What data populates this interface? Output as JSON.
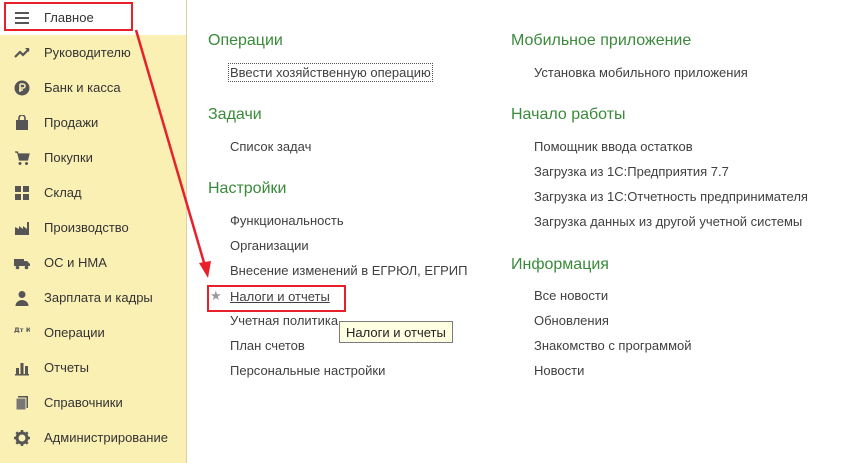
{
  "sidebar": {
    "items": [
      {
        "label": "Главное",
        "icon": "menu-lines-icon",
        "active": true
      },
      {
        "label": "Руководителю",
        "icon": "trend-up-icon"
      },
      {
        "label": "Банк и касса",
        "icon": "ruble-coin-icon"
      },
      {
        "label": "Продажи",
        "icon": "shopping-bag-icon"
      },
      {
        "label": "Покупки",
        "icon": "shopping-cart-icon"
      },
      {
        "label": "Склад",
        "icon": "warehouse-grid-icon"
      },
      {
        "label": "Производство",
        "icon": "factory-icon"
      },
      {
        "label": "ОС и НМА",
        "icon": "truck-icon"
      },
      {
        "label": "Зарплата и кадры",
        "icon": "person-icon"
      },
      {
        "label": "Операции",
        "icon": "debit-credit-icon"
      },
      {
        "label": "Отчеты",
        "icon": "bar-chart-icon"
      },
      {
        "label": "Справочники",
        "icon": "books-icon"
      },
      {
        "label": "Администрирование",
        "icon": "gear-icon"
      }
    ],
    "icon_glyph_dtkt": "Дт Кт"
  },
  "left_column": {
    "operations": {
      "title": "Операции",
      "links": [
        "Ввести хозяйственную операцию"
      ]
    },
    "tasks": {
      "title": "Задачи",
      "links": [
        "Список задач"
      ]
    },
    "settings": {
      "title": "Настройки",
      "links": [
        "Функциональность",
        "Организации",
        "Внесение изменений в ЕГРЮЛ, ЕГРИП",
        "Налоги и отчеты",
        "Учетная политика",
        "План счетов",
        "Персональные настройки"
      ]
    }
  },
  "right_column": {
    "mobile": {
      "title": "Мобильное приложение",
      "links": [
        "Установка мобильного приложения"
      ]
    },
    "start": {
      "title": "Начало работы",
      "links": [
        "Помощник ввода остатков",
        "Загрузка из 1С:Предприятия 7.7",
        "Загрузка из 1С:Отчетность предпринимателя",
        "Загрузка данных из другой учетной системы"
      ]
    },
    "info": {
      "title": "Информация",
      "links": [
        "Все новости",
        "Обновления",
        "Знакомство с программой",
        "Новости"
      ]
    }
  },
  "tooltip": {
    "text": "Налоги и отчеты"
  },
  "colors": {
    "sidebar_bg": "#fbf0b4",
    "section_title": "#3a8a3a",
    "annotation_red": "#e8202a",
    "tooltip_bg": "#ffffe1"
  }
}
